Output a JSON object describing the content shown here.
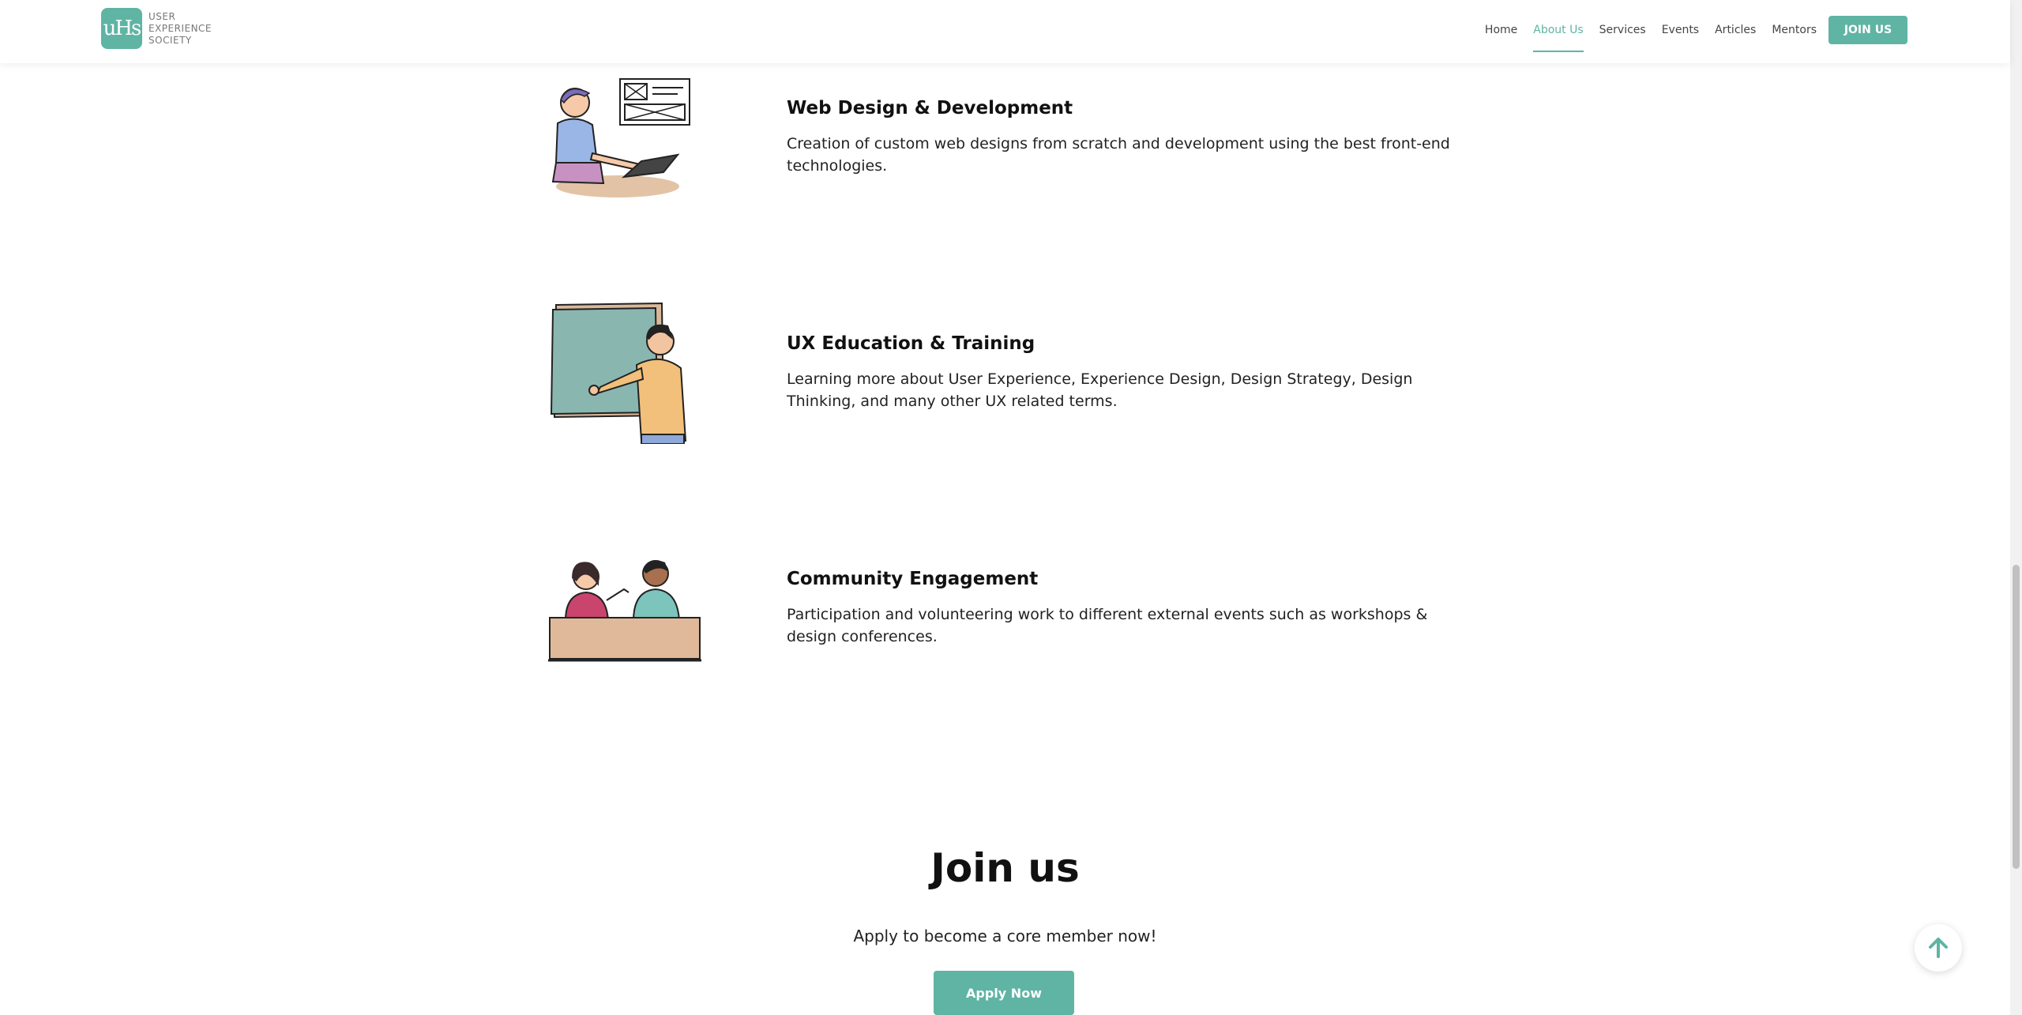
{
  "header": {
    "logo": {
      "mark": "uHs",
      "lines": [
        "USER",
        "EXPERIENCE",
        "SOCIETY"
      ]
    },
    "nav": [
      {
        "label": "Home",
        "active": false
      },
      {
        "label": "About Us",
        "active": true
      },
      {
        "label": "Services",
        "active": false
      },
      {
        "label": "Events",
        "active": false
      },
      {
        "label": "Articles",
        "active": false
      },
      {
        "label": "Mentors",
        "active": false
      }
    ],
    "cta_label": "JOIN US"
  },
  "services": [
    {
      "title": "Web Design & Development",
      "description": "Creation of custom web designs from scratch and development using the best front-end technologies.",
      "illustration": "person-at-laptop-icon"
    },
    {
      "title": "UX Education & Training",
      "description": "Learning more about User Experience, Experience Design, Design Strategy, Design Thinking, and many other UX related terms.",
      "illustration": "teacher-chalkboard-icon"
    },
    {
      "title": "Community Engagement",
      "description": "Participation and volunteering work to different external events such as workshops & design conferences.",
      "illustration": "two-people-talking-icon"
    }
  ],
  "join": {
    "title": "Join us",
    "subtitle": "Apply to become a core member now!",
    "button_label": "Apply Now"
  },
  "colors": {
    "accent": "#5fb4a4",
    "text": "#111111",
    "background": "#ffffff"
  }
}
